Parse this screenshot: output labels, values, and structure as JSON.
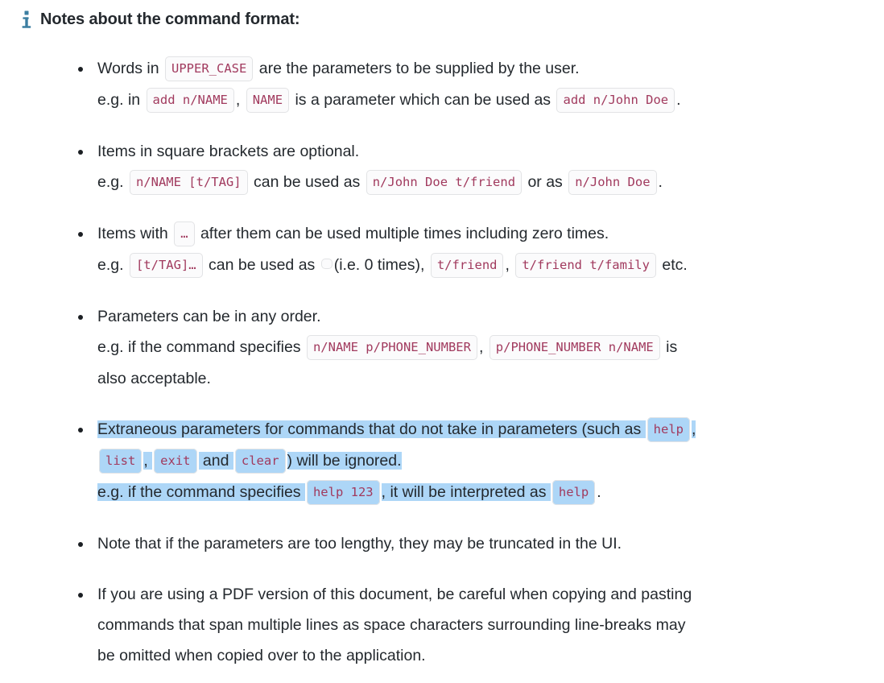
{
  "header": {
    "icon": "info-icon",
    "title": "Notes about the command format:",
    "icon_color": "#3b7ea1"
  },
  "colors": {
    "code_text": "#a13a5e",
    "code_bg": "#fbfbfc",
    "code_border": "#e2e3e5",
    "body_text": "#24292e",
    "selection_highlight": "#add6f7",
    "bullet": "#1b1f23"
  },
  "notes": [
    {
      "id": "upper-case-params",
      "lines": [
        {
          "parts": [
            {
              "t": "text",
              "v": "Words in "
            },
            {
              "t": "code",
              "v": "UPPER_CASE"
            },
            {
              "t": "text",
              "v": " are the parameters to be supplied by the user."
            }
          ]
        },
        {
          "parts": [
            {
              "t": "text",
              "v": "e.g. in "
            },
            {
              "t": "code",
              "v": "add n/NAME"
            },
            {
              "t": "text",
              "v": ", "
            },
            {
              "t": "code",
              "v": "NAME"
            },
            {
              "t": "text",
              "v": " is a parameter which can be used as "
            },
            {
              "t": "code",
              "v": "add n/John Doe"
            },
            {
              "t": "text",
              "v": "."
            }
          ]
        }
      ]
    },
    {
      "id": "square-brackets-optional",
      "lines": [
        {
          "parts": [
            {
              "t": "text",
              "v": "Items in square brackets are optional."
            }
          ]
        },
        {
          "parts": [
            {
              "t": "text",
              "v": "e.g. "
            },
            {
              "t": "code",
              "v": "n/NAME [t/TAG]"
            },
            {
              "t": "text",
              "v": " can be used as "
            },
            {
              "t": "code",
              "v": "n/John Doe t/friend"
            },
            {
              "t": "text",
              "v": " or as "
            },
            {
              "t": "code",
              "v": "n/John Doe"
            },
            {
              "t": "text",
              "v": "."
            }
          ]
        }
      ]
    },
    {
      "id": "ellipsis-multiple-times",
      "lines": [
        {
          "parts": [
            {
              "t": "text",
              "v": "Items with "
            },
            {
              "t": "code",
              "v": "…"
            },
            {
              "t": "text",
              "v": " after them can be used multiple times including zero times."
            }
          ]
        },
        {
          "parts": [
            {
              "t": "text",
              "v": "e.g. "
            },
            {
              "t": "code",
              "v": "[t/TAG]…"
            },
            {
              "t": "text",
              "v": " can be used as "
            },
            {
              "t": "code",
              "v": ""
            },
            {
              "t": "text",
              "v": "(i.e. 0 times), "
            },
            {
              "t": "code",
              "v": "t/friend"
            },
            {
              "t": "text",
              "v": ", "
            },
            {
              "t": "code",
              "v": "t/friend t/family"
            },
            {
              "t": "text",
              "v": " etc."
            }
          ]
        }
      ]
    },
    {
      "id": "parameters-any-order",
      "lines": [
        {
          "parts": [
            {
              "t": "text",
              "v": "Parameters can be in any order."
            }
          ]
        },
        {
          "parts": [
            {
              "t": "text",
              "v": "e.g. if the command specifies "
            },
            {
              "t": "code",
              "v": "n/NAME p/PHONE_NUMBER"
            },
            {
              "t": "text",
              "v": ", "
            },
            {
              "t": "code",
              "v": "p/PHONE_NUMBER n/NAME"
            },
            {
              "t": "text",
              "v": " is"
            }
          ]
        },
        {
          "parts": [
            {
              "t": "text",
              "v": "also acceptable."
            }
          ]
        }
      ]
    },
    {
      "id": "extraneous-parameters-ignored",
      "selected": true,
      "lines": [
        {
          "parts": [
            {
              "t": "text",
              "v": "Extraneous parameters for commands that do not take in parameters (such as ",
              "hl": true
            },
            {
              "t": "code",
              "v": "help",
              "hl": true
            },
            {
              "t": "text",
              "v": ",",
              "hl": true
            }
          ]
        },
        {
          "parts": [
            {
              "t": "code",
              "v": "list",
              "hl": true
            },
            {
              "t": "text",
              "v": ", ",
              "hl": true
            },
            {
              "t": "code",
              "v": "exit",
              "hl": true
            },
            {
              "t": "text",
              "v": " and ",
              "hl": true
            },
            {
              "t": "code",
              "v": "clear",
              "hl": true
            },
            {
              "t": "text",
              "v": ") will be ignored.",
              "hl": true
            }
          ]
        },
        {
          "parts": [
            {
              "t": "text",
              "v": "e.g. if the command specifies ",
              "hl": true
            },
            {
              "t": "code",
              "v": "help 123",
              "hl": true
            },
            {
              "t": "text",
              "v": ", it will be interpreted as ",
              "hl": true
            },
            {
              "t": "code",
              "v": "help",
              "hl": true
            },
            {
              "t": "text",
              "v": "."
            }
          ]
        }
      ]
    },
    {
      "id": "lengthy-parameters-truncated",
      "lines": [
        {
          "parts": [
            {
              "t": "text",
              "v": "Note that if the parameters are too lengthy, they may be truncated in the UI."
            }
          ]
        }
      ]
    },
    {
      "id": "pdf-copy-paste-warning",
      "lines": [
        {
          "parts": [
            {
              "t": "text",
              "v": "If you are using a PDF version of this document, be careful when copying and pasting"
            }
          ]
        },
        {
          "parts": [
            {
              "t": "text",
              "v": "commands that span multiple lines as space characters surrounding line-breaks may"
            }
          ]
        },
        {
          "parts": [
            {
              "t": "text",
              "v": "be omitted when copied over to the application."
            }
          ]
        }
      ]
    }
  ]
}
